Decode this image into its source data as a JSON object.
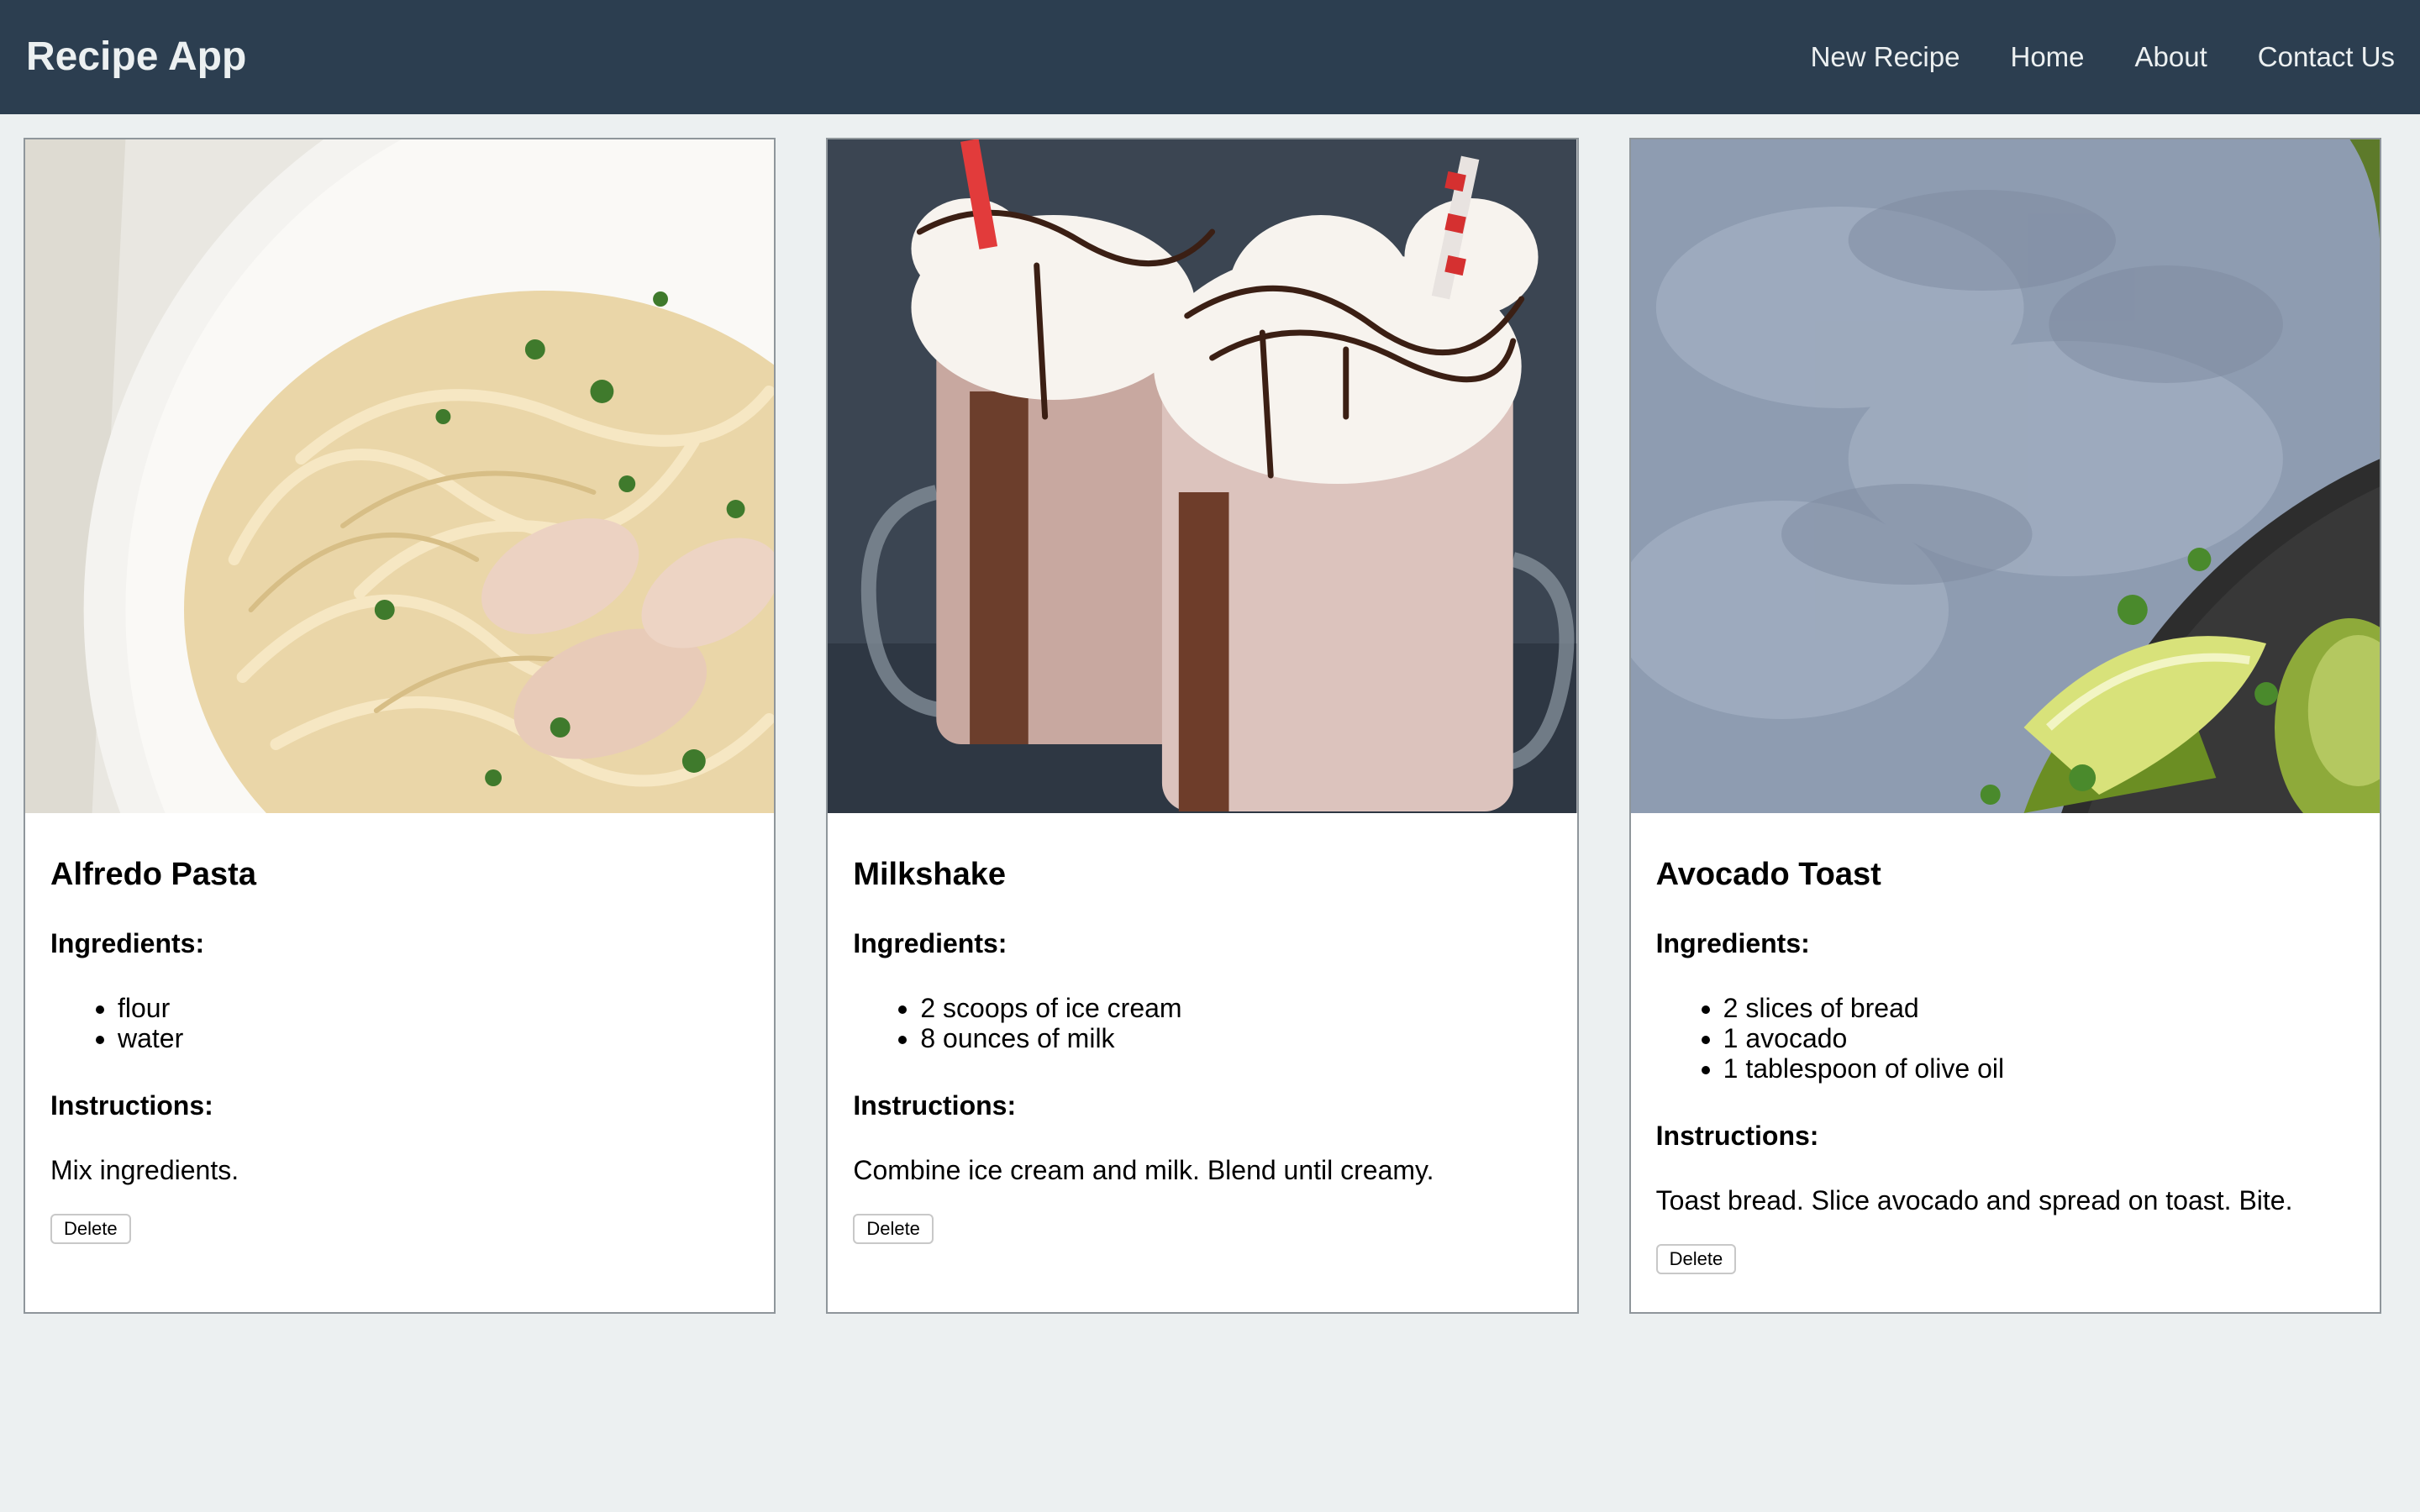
{
  "navbar": {
    "brand": "Recipe App",
    "links": [
      "New Recipe",
      "Home",
      "About",
      "Contact Us"
    ]
  },
  "recipes": [
    {
      "title": "Alfredo Pasta",
      "ingredients_label": "Ingredients:",
      "ingredients": [
        "flour",
        "water"
      ],
      "instructions_label": "Instructions:",
      "instructions": "Mix ingredients.",
      "delete_label": "Delete"
    },
    {
      "title": "Milkshake",
      "ingredients_label": "Ingredients:",
      "ingredients": [
        "2 scoops of ice cream",
        "8 ounces of milk"
      ],
      "instructions_label": "Instructions:",
      "instructions": "Combine ice cream and milk. Blend until creamy.",
      "delete_label": "Delete"
    },
    {
      "title": "Avocado Toast",
      "ingredients_label": "Ingredients:",
      "ingredients": [
        "2 slices of bread",
        "1 avocado",
        "1 tablespoon of olive oil"
      ],
      "instructions_label": "Instructions:",
      "instructions": "Toast bread. Slice avocado and spread on toast. Bite.",
      "delete_label": "Delete"
    }
  ],
  "colors": {
    "navbar_bg": "#2c3e50",
    "navbar_text": "#ecf0f1",
    "page_bg": "#ecf0f1",
    "card_border": "#8f969b"
  }
}
